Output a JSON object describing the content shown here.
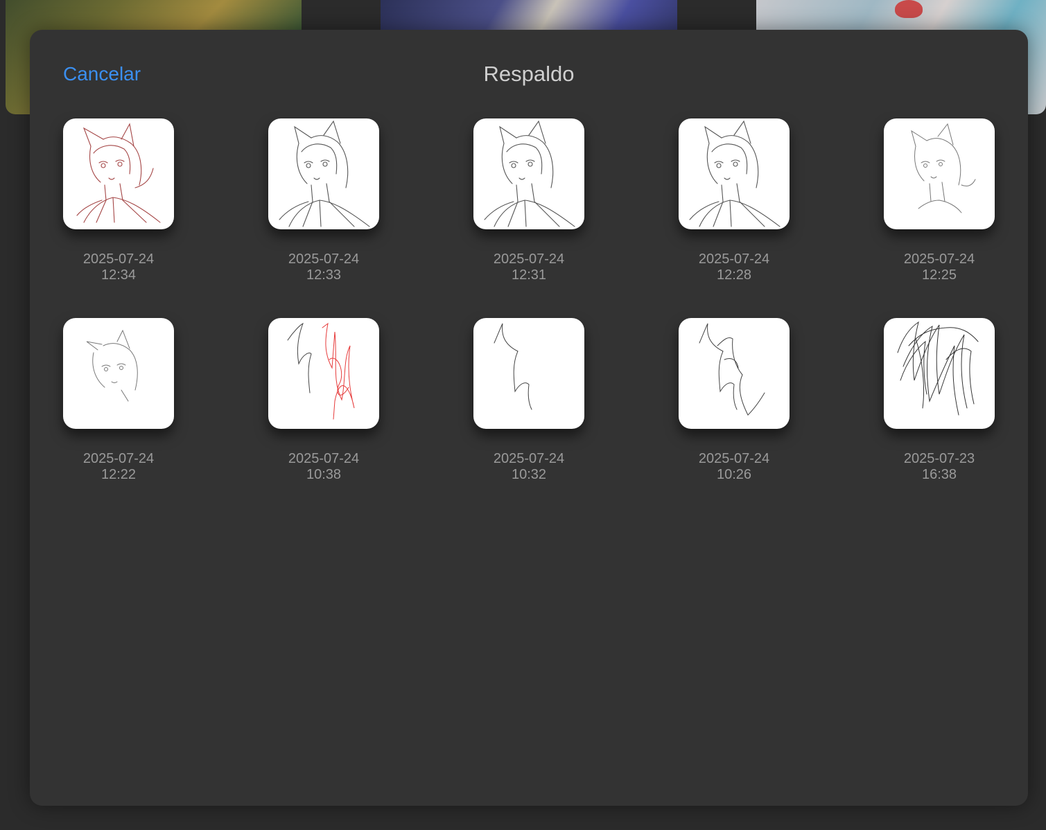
{
  "header": {
    "cancel_label": "Cancelar",
    "title": "Respaldo"
  },
  "backups": [
    {
      "date": "2025-07-24",
      "time": "12:34",
      "icon": "sketch-red-cat-girl"
    },
    {
      "date": "2025-07-24",
      "time": "12:33",
      "icon": "sketch-cat-girl"
    },
    {
      "date": "2025-07-24",
      "time": "12:31",
      "icon": "sketch-cat-girl"
    },
    {
      "date": "2025-07-24",
      "time": "12:28",
      "icon": "sketch-cat-girl"
    },
    {
      "date": "2025-07-24",
      "time": "12:25",
      "icon": "sketch-cat-girl-light"
    },
    {
      "date": "2025-07-24",
      "time": "12:22",
      "icon": "sketch-cat-girl-head"
    },
    {
      "date": "2025-07-24",
      "time": "10:38",
      "icon": "scribble-red"
    },
    {
      "date": "2025-07-24",
      "time": "10:32",
      "icon": "scribble-single"
    },
    {
      "date": "2025-07-24",
      "time": "10:26",
      "icon": "scribble-double"
    },
    {
      "date": "2025-07-23",
      "time": "16:38",
      "icon": "scribble-dense"
    }
  ]
}
